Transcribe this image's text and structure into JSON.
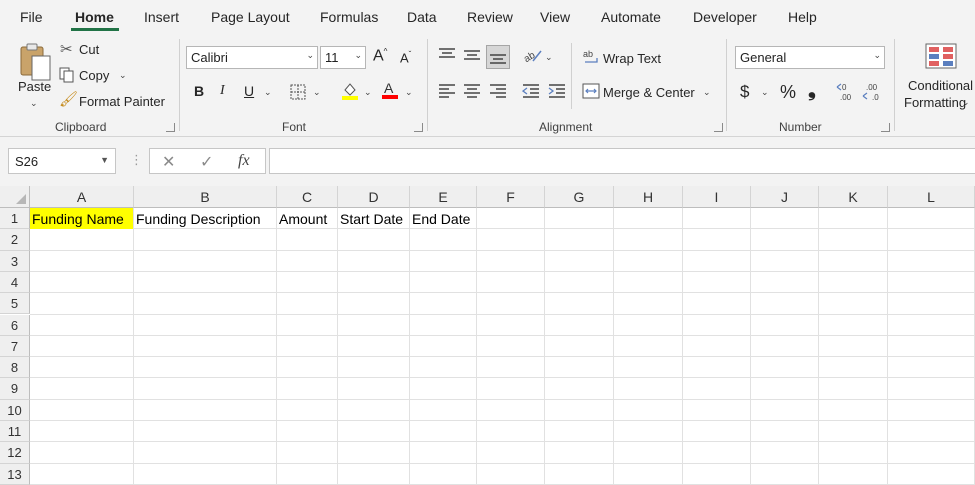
{
  "menu": {
    "tabs": [
      "File",
      "Home",
      "Insert",
      "Page Layout",
      "Formulas",
      "Data",
      "Review",
      "View",
      "Automate",
      "Developer",
      "Help"
    ],
    "active_tab": "Home"
  },
  "ribbon": {
    "clipboard": {
      "paste_label": "Paste",
      "cut_label": "Cut",
      "copy_label": "Copy",
      "format_painter_label": "Format Painter",
      "group_label": "Clipboard"
    },
    "font": {
      "font_name": "Calibri",
      "font_size": "11",
      "bold": "B",
      "italic": "I",
      "underline": "U",
      "increase_font": "A",
      "decrease_font": "A",
      "group_label": "Font",
      "fill_color": "#ffff00",
      "font_color": "#ff0000"
    },
    "alignment": {
      "wrap_text_label": "Wrap Text",
      "merge_center_label": "Merge & Center",
      "group_label": "Alignment"
    },
    "number": {
      "format": "General",
      "currency": "$",
      "percent": "%",
      "comma": "❟",
      "group_label": "Number"
    },
    "styles": {
      "conditional_label_1": "Conditional",
      "conditional_label_2": "Formatting"
    }
  },
  "formula_bar": {
    "name_box": "S26",
    "fx_label": "fx",
    "value": ""
  },
  "grid": {
    "columns": [
      "A",
      "B",
      "C",
      "D",
      "E",
      "F",
      "G",
      "H",
      "I",
      "J",
      "K",
      "L"
    ],
    "rows": [
      "1",
      "2",
      "3",
      "4",
      "5",
      "6",
      "7",
      "8",
      "9",
      "10",
      "11",
      "12",
      "13"
    ],
    "row1": [
      "Funding Name",
      "Funding Description",
      "Amount",
      "Start Date",
      "End Date"
    ],
    "highlight_color": "#ffff00"
  }
}
